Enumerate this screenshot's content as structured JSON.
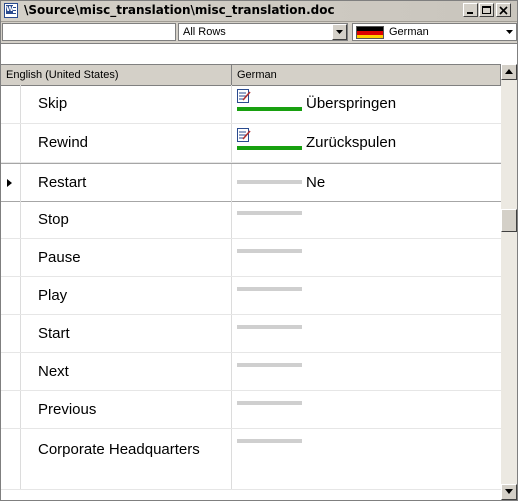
{
  "window": {
    "title": "\\Source\\misc_translation\\misc_translation.doc",
    "icon": "word-document-icon"
  },
  "filter": {
    "search_value": "",
    "rows_filter": "All Rows",
    "language": "German",
    "language_flag": "germany-flag-icon"
  },
  "grid": {
    "columns": [
      "English (United States)",
      "German"
    ],
    "rows": [
      {
        "source": "Skip",
        "target": "Überspringen",
        "status": "translated",
        "edited": true,
        "current": false
      },
      {
        "source": "Rewind",
        "target": "Zurückspulen",
        "status": "translated",
        "edited": true,
        "current": false
      },
      {
        "source": "Restart",
        "target": "Ne",
        "status": "untranslated",
        "edited": false,
        "current": true
      },
      {
        "source": "Stop",
        "target": "",
        "status": "untranslated",
        "edited": false,
        "current": false
      },
      {
        "source": "Pause",
        "target": "",
        "status": "untranslated",
        "edited": false,
        "current": false
      },
      {
        "source": "Play",
        "target": "",
        "status": "untranslated",
        "edited": false,
        "current": false
      },
      {
        "source": "Start",
        "target": "",
        "status": "untranslated",
        "edited": false,
        "current": false
      },
      {
        "source": "Next",
        "target": "",
        "status": "untranslated",
        "edited": false,
        "current": false
      },
      {
        "source": "Previous",
        "target": "",
        "status": "untranslated",
        "edited": false,
        "current": false
      },
      {
        "source": "Corporate Headquarters",
        "target": "",
        "status": "untranslated",
        "edited": false,
        "current": false
      }
    ]
  },
  "colors": {
    "translated": "#18a010",
    "untranslated": "#cfcfcf",
    "chrome": "#d4d0c8"
  }
}
